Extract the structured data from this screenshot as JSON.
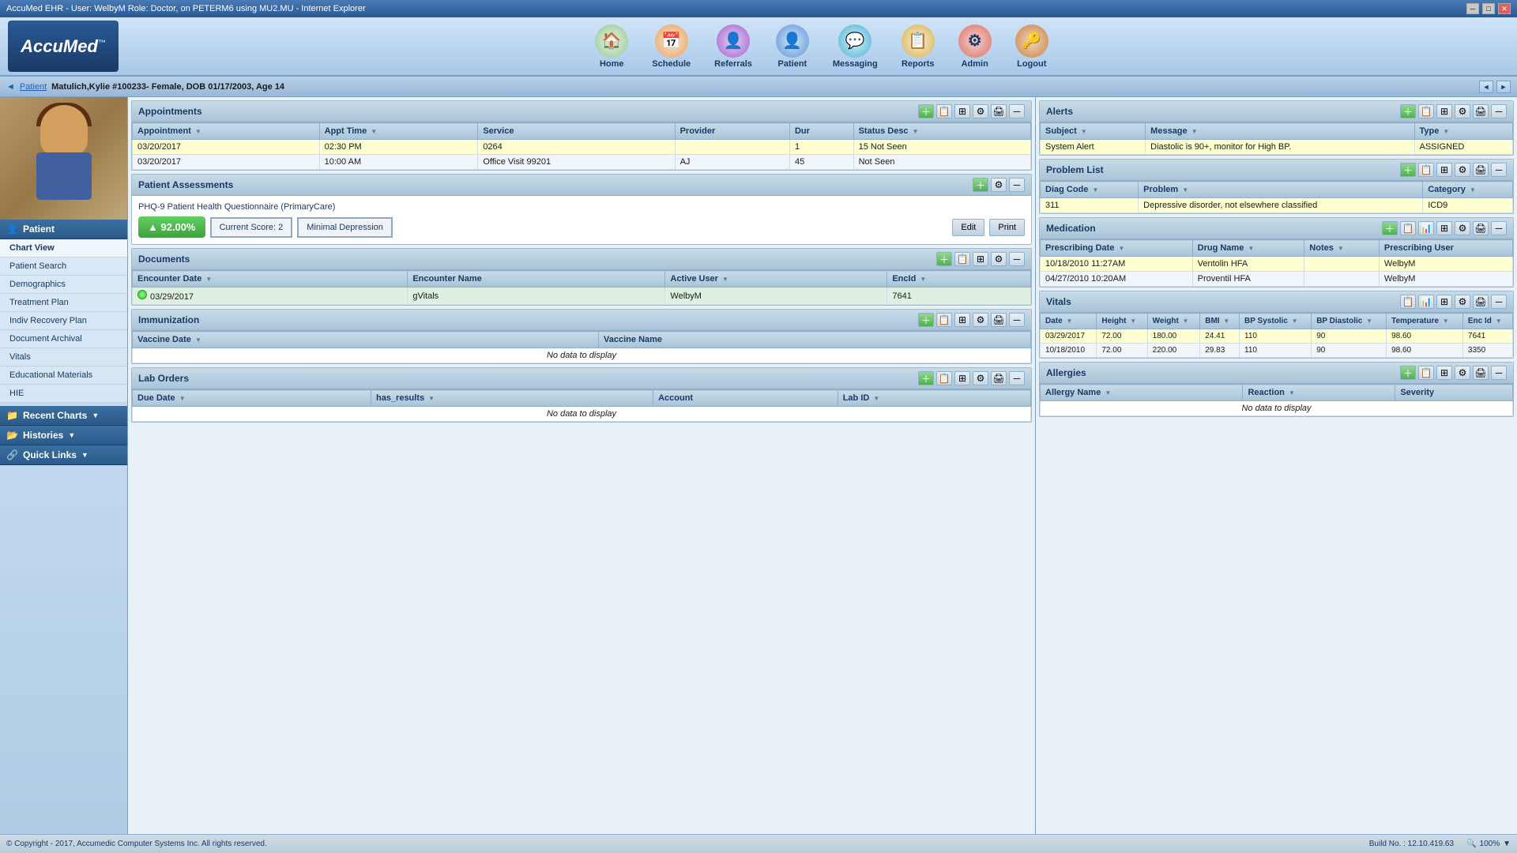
{
  "window": {
    "title": "AccuMed EHR - User: WelbyM Role: Doctor, on PETERM6 using MU2.MU - Internet Explorer"
  },
  "nav": {
    "logo": "AccuMed",
    "tm": "™",
    "items": [
      {
        "id": "home",
        "label": "Home",
        "icon": "🏠"
      },
      {
        "id": "schedule",
        "label": "Schedule",
        "icon": "📅"
      },
      {
        "id": "referrals",
        "label": "Referrals",
        "icon": "👤"
      },
      {
        "id": "patient",
        "label": "Patient",
        "icon": "👤"
      },
      {
        "id": "messaging",
        "label": "Messaging",
        "icon": "💬"
      },
      {
        "id": "reports",
        "label": "Reports",
        "icon": "📋"
      },
      {
        "id": "admin",
        "label": "Admin",
        "icon": "⚙"
      },
      {
        "id": "logout",
        "label": "Logout",
        "icon": "🔑"
      }
    ]
  },
  "patient_bar": {
    "back_label": "◄",
    "breadcrumb": "Patient",
    "info": "Matulich,Kylie #100233- Female, DOB 01/17/2003, Age 14"
  },
  "sidebar": {
    "section_label": "Patient",
    "chart_view": "Chart View",
    "items": [
      {
        "id": "patient-search",
        "label": "Patient Search"
      },
      {
        "id": "demographics",
        "label": "Demographics"
      },
      {
        "id": "treatment-plan",
        "label": "Treatment Plan"
      },
      {
        "id": "indiv-recovery-plan",
        "label": "Indiv Recovery Plan"
      },
      {
        "id": "document-archival",
        "label": "Document Archival"
      },
      {
        "id": "vitals",
        "label": "Vitals"
      },
      {
        "id": "educational-materials",
        "label": "Educational Materials"
      },
      {
        "id": "hie",
        "label": "HIE"
      }
    ],
    "recent_charts": "Recent Charts",
    "histories": "Histories",
    "quick_links": "Quick Links"
  },
  "appointments": {
    "title": "Appointments",
    "columns": [
      "Appointment",
      "Appt Time",
      "Service",
      "Provider",
      "Dur",
      "Status Desc"
    ],
    "rows": [
      {
        "appointment": "03/20/2017",
        "appt_time": "02:30 PM",
        "service": "0264",
        "provider": "",
        "dur": "1",
        "status_desc": "15 Not Seen"
      },
      {
        "appointment": "03/20/2017",
        "appt_time": "10:00 AM",
        "service": "Office Visit 99201",
        "provider": "AJ",
        "dur": "45",
        "status_desc": "Not Seen"
      }
    ]
  },
  "patient_assessments": {
    "title": "Patient Assessments",
    "phq_label": "PHQ-9 Patient Health Questionnaire (PrimaryCare)",
    "score_pct": "▲ 92.00%",
    "current_score_label": "Current Score: 2",
    "depression_label": "Minimal Depression",
    "edit_label": "Edit",
    "print_label": "Print"
  },
  "documents": {
    "title": "Documents",
    "columns": [
      "Encounter Date",
      "Encounter Name",
      "Active User",
      "EncId"
    ],
    "rows": [
      {
        "encounter_date": "03/29/2017",
        "encounter_name": "gVitals",
        "active_user": "WelbyM",
        "enc_id": "7641",
        "highlight": true
      }
    ]
  },
  "immunization": {
    "title": "Immunization",
    "columns": [
      "Vaccine Date",
      "Vaccine Name"
    ],
    "no_data": "No data to display"
  },
  "lab_orders": {
    "title": "Lab Orders",
    "columns": [
      "Due Date",
      "has_results",
      "Account",
      "Lab ID"
    ],
    "no_data": "No data to display"
  },
  "alerts": {
    "title": "Alerts",
    "columns": [
      "Subject",
      "Message",
      "Type"
    ],
    "rows": [
      {
        "subject": "System Alert",
        "message": "Diastolic is 90+, monitor for High BP.",
        "type": "ASSIGNED",
        "highlight": true
      }
    ]
  },
  "problem_list": {
    "title": "Problem List",
    "columns": [
      "Diag Code",
      "Problem",
      "Category"
    ],
    "rows": [
      {
        "diag_code": "311",
        "problem": "Depressive disorder, not elsewhere classified",
        "category": "ICD9",
        "highlight": true
      }
    ]
  },
  "medication": {
    "title": "Medication",
    "columns": [
      "Prescribing Date",
      "Drug Name",
      "Notes",
      "Prescribing User"
    ],
    "rows": [
      {
        "prescribing_date": "10/18/2010 11:27AM",
        "drug_name": "Ventolin HFA",
        "notes": "",
        "prescribing_user": "WelbyM",
        "highlight": true
      },
      {
        "prescribing_date": "04/27/2010 10:20AM",
        "drug_name": "Proventil HFA",
        "notes": "",
        "prescribing_user": "WelbyM",
        "highlight": false
      }
    ]
  },
  "vitals": {
    "title": "Vitals",
    "columns": [
      "Date",
      "Height",
      "Weight",
      "BMI",
      "BP Systolic",
      "BP Diastolic",
      "Temperature",
      "Enc Id"
    ],
    "rows": [
      {
        "date": "03/29/2017",
        "height": "72.00",
        "weight": "180.00",
        "bmi": "24.41",
        "bp_systolic": "110",
        "bp_diastolic": "90",
        "temperature": "98.60",
        "enc_id": "7641"
      },
      {
        "date": "10/18/2010",
        "height": "72.00",
        "weight": "220.00",
        "bmi": "29.83",
        "bp_systolic": "110",
        "bp_diastolic": "90",
        "temperature": "98.60",
        "enc_id": "3350"
      }
    ]
  },
  "allergies": {
    "title": "Allergies",
    "columns": [
      "Allergy Name",
      "Reaction",
      "Severity"
    ],
    "no_data": "No data to display"
  },
  "status_bar": {
    "copyright": "© Copyright - 2017, Accumedic Computer Systems Inc. All rights reserved.",
    "build": "Build No. : 12.10.419.63",
    "zoom": "🔍 100%"
  }
}
